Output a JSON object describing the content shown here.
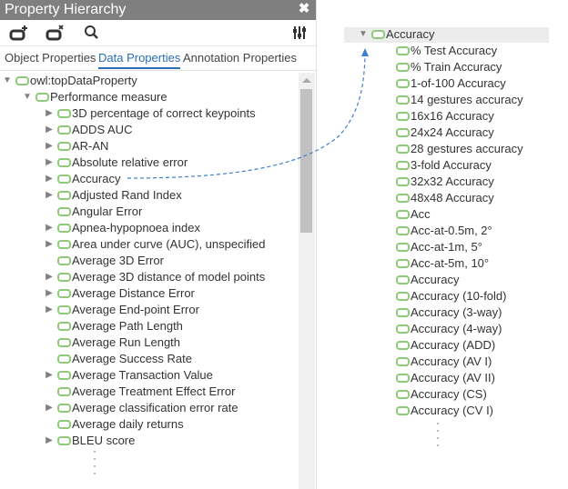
{
  "panel": {
    "title": "Property Hierarchy",
    "close_icon": "close-icon",
    "toolbar": {
      "add_property_icon": "add-property-icon",
      "delete_property_icon": "delete-property-icon",
      "search_icon": "search-icon",
      "settings_icon": "sliders-icon"
    },
    "tabs": [
      {
        "label": "Object Properties",
        "active": false
      },
      {
        "label": "Data Properties",
        "active": true
      },
      {
        "label": "Annotation Properties",
        "active": false
      }
    ],
    "tree": [
      {
        "label": "owl:topDataProperty",
        "depth": 0,
        "toggle": "expanded"
      },
      {
        "label": "Performance measure",
        "depth": 1,
        "toggle": "expanded"
      },
      {
        "label": "3D percentage of correct keypoints",
        "depth": 2,
        "toggle": "collapsed"
      },
      {
        "label": "ADDS AUC",
        "depth": 2,
        "toggle": "collapsed"
      },
      {
        "label": "AR-AN",
        "depth": 2,
        "toggle": "collapsed"
      },
      {
        "label": "Absolute relative error",
        "depth": 2,
        "toggle": "collapsed"
      },
      {
        "label": "Accuracy",
        "depth": 2,
        "toggle": "collapsed"
      },
      {
        "label": "Adjusted Rand Index",
        "depth": 2,
        "toggle": "collapsed"
      },
      {
        "label": "Angular Error",
        "depth": 2,
        "toggle": "none"
      },
      {
        "label": "Apnea-hypopnoea index",
        "depth": 2,
        "toggle": "collapsed"
      },
      {
        "label": "Area under curve (AUC), unspecified",
        "depth": 2,
        "toggle": "collapsed"
      },
      {
        "label": "Average 3D Error",
        "depth": 2,
        "toggle": "none"
      },
      {
        "label": "Average 3D distance of model points",
        "depth": 2,
        "toggle": "collapsed"
      },
      {
        "label": "Average Distance Error",
        "depth": 2,
        "toggle": "collapsed"
      },
      {
        "label": "Average End-point Error",
        "depth": 2,
        "toggle": "collapsed"
      },
      {
        "label": "Average Path Length",
        "depth": 2,
        "toggle": "none"
      },
      {
        "label": "Average Run Length",
        "depth": 2,
        "toggle": "none"
      },
      {
        "label": "Average Success Rate",
        "depth": 2,
        "toggle": "none"
      },
      {
        "label": "Average Transaction Value",
        "depth": 2,
        "toggle": "collapsed"
      },
      {
        "label": "Average Treatment Effect Error",
        "depth": 2,
        "toggle": "none"
      },
      {
        "label": "Average classification error rate",
        "depth": 2,
        "toggle": "collapsed"
      },
      {
        "label": "Average daily returns",
        "depth": 2,
        "toggle": "none"
      },
      {
        "label": "BLEU score",
        "depth": 2,
        "toggle": "collapsed"
      }
    ]
  },
  "expanded_view": {
    "header": {
      "label": "Accuracy",
      "toggle": "expanded"
    },
    "children": [
      "% Test Accuracy",
      "% Train Accuracy",
      "1-of-100 Accuracy",
      "14 gestures accuracy",
      "16x16 Accuracy",
      "24x24 Accuracy",
      "28 gestures accuracy",
      "3-fold Accuracy",
      "32x32 Accuracy",
      "48x48 Accuracy",
      "Acc",
      "Acc-at-0.5m, 2°",
      "Acc-at-1m, 5°",
      "Acc-at-5m, 10°",
      "Accuracy",
      "Accuracy (10-fold)",
      "Accuracy (3-way)",
      "Accuracy (4-way)",
      "Accuracy (ADD)",
      "Accuracy (AV I)",
      "Accuracy (AV II)",
      "Accuracy (CS)",
      "Accuracy (CV I)"
    ]
  },
  "colors": {
    "titlebar": "#7f7f7f",
    "accent": "#2a6ebb",
    "property_icon": "#8fc97a",
    "connector": "#3d7fd0"
  },
  "glyphs": {
    "expanded": "▼",
    "collapsed": "▶",
    "close": "✖"
  }
}
